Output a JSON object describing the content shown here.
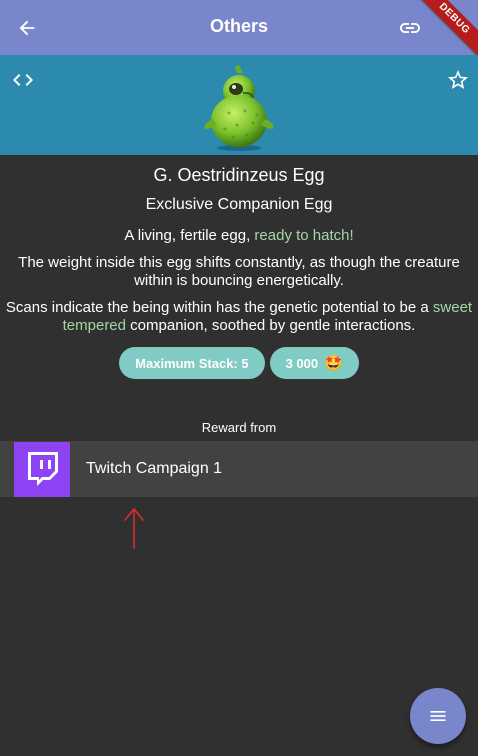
{
  "appbar": {
    "title": "Others",
    "back_icon": "arrow-back-icon",
    "link_icon": "link-icon",
    "share_icon": "share-icon",
    "debug_label": "DEBUG"
  },
  "banner": {
    "code_icon": "code-icon",
    "star_icon": "star-outline-icon",
    "image": "green-creature-egg-image"
  },
  "item": {
    "name": "G. Oestridinzeus Egg",
    "subtitle": "Exclusive Companion Egg",
    "desc1_pre": "A living, fertile egg, ",
    "desc1_hl": "ready to hatch!",
    "desc2": "The weight inside this egg shifts constantly, as though the creature within is bouncing energetically.",
    "desc3_pre": "Scans indicate the being within has the genetic potential to be a ",
    "desc3_hl": "sweet tempered",
    "desc3_post": " companion, soothed by gentle interactions.",
    "stack_label": "Maximum Stack: 5",
    "price_label": "3 000",
    "price_emoji": "🤩"
  },
  "reward": {
    "label": "Reward from",
    "source": "Twitch Campaign 1",
    "icon": "twitch-icon"
  },
  "fab": {
    "icon": "menu-icon"
  },
  "colors": {
    "appbar": "#7986cb",
    "banner": "#2b8aad",
    "background": "#303030",
    "highlight": "#a5d6a7",
    "chip": "#80cbc4",
    "twitch": "#8e44f5"
  }
}
